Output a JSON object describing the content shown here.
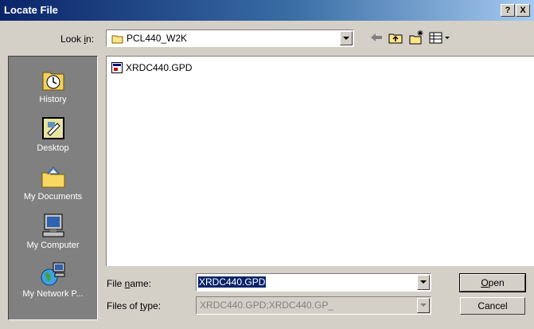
{
  "window": {
    "title": "Locate File"
  },
  "title_buttons": {
    "help": "?",
    "close": "X"
  },
  "look_in": {
    "label_pre": "Look ",
    "label_key": "i",
    "label_post": "n:",
    "value": "PCL440_W2K"
  },
  "places": [
    {
      "label": "History",
      "icon": "history-icon"
    },
    {
      "label": "Desktop",
      "icon": "desktop-icon"
    },
    {
      "label": "My Documents",
      "icon": "my-documents-icon"
    },
    {
      "label": "My Computer",
      "icon": "my-computer-icon"
    },
    {
      "label": "My Network P...",
      "icon": "my-network-places-icon"
    }
  ],
  "files": [
    {
      "name": "XRDC440.GPD",
      "icon": "gpd-file-icon"
    }
  ],
  "file_name": {
    "label_pre": "File ",
    "label_key": "n",
    "label_post": "ame:",
    "value": "XRDC440.GPD"
  },
  "file_type": {
    "label_pre": "Files of ",
    "label_key": "t",
    "label_post": "ype:",
    "value": "XRDC440.GPD;XRDC440.GP_"
  },
  "buttons": {
    "open_key": "O",
    "open_rest": "pen",
    "cancel": "Cancel"
  }
}
